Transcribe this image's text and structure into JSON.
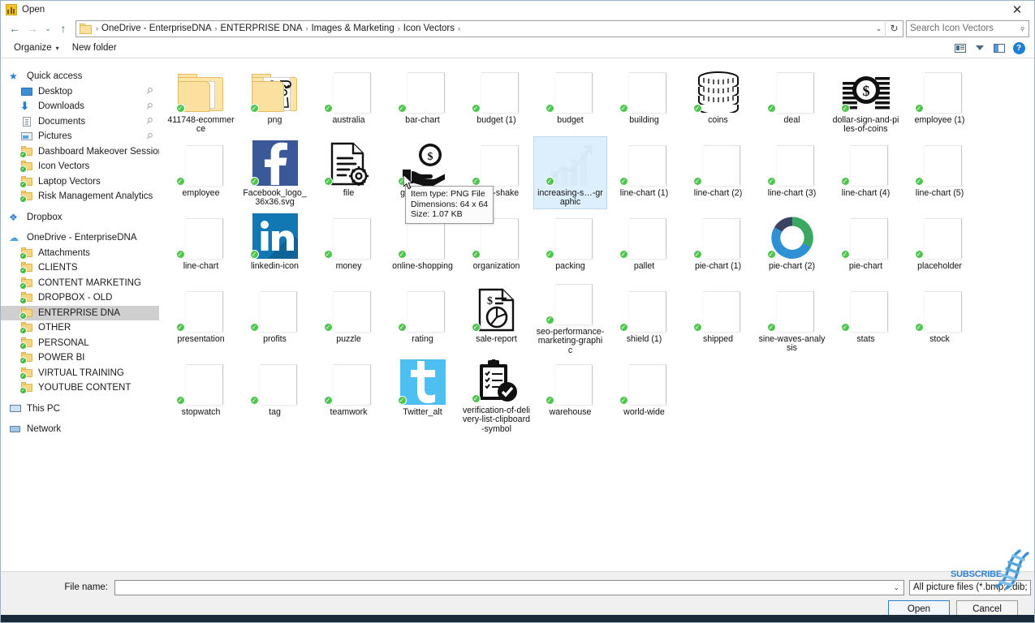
{
  "window": {
    "title": "Open",
    "close_label": "✕",
    "icon": "chart-app-icon"
  },
  "nav": {
    "back": "←",
    "forward": "→",
    "recent": "⌄",
    "up": "↑",
    "breadcrumbs": [
      "OneDrive - EnterpriseDNA",
      "ENTERPRISE DNA",
      "Images & Marketing",
      "Icon Vectors"
    ],
    "separator": "›",
    "address_caret": "⌄",
    "refresh": "↻",
    "search_placeholder": "Search Icon Vectors",
    "search_icon": "search-icon"
  },
  "command_bar": {
    "organize": "Organize",
    "organize_caret": "▾",
    "new_folder": "New folder",
    "view_icon": "view-layout-icon",
    "view_caret_icon": "chevron-down-icon",
    "preview_pane_icon": "preview-pane-icon",
    "help_icon": "help-icon",
    "help_glyph": "?"
  },
  "sidebar": {
    "items": [
      {
        "label": "Quick access",
        "icon": "star-icon",
        "kind": "group",
        "pinned": false
      },
      {
        "label": "Desktop",
        "icon": "desktop-icon",
        "kind": "child",
        "pinned": true
      },
      {
        "label": "Downloads",
        "icon": "downloads-icon",
        "kind": "child",
        "pinned": true
      },
      {
        "label": "Documents",
        "icon": "documents-icon",
        "kind": "child",
        "pinned": true
      },
      {
        "label": "Pictures",
        "icon": "pictures-icon",
        "kind": "child",
        "pinned": true
      },
      {
        "label": "Dashboard Makeover Session",
        "icon": "folder-synced-icon",
        "kind": "child",
        "pinned": false
      },
      {
        "label": "Icon Vectors",
        "icon": "folder-synced-icon",
        "kind": "child",
        "pinned": false
      },
      {
        "label": "Laptop Vectors",
        "icon": "folder-synced-icon",
        "kind": "child",
        "pinned": false
      },
      {
        "label": "Risk Management Analytics",
        "icon": "folder-synced-icon",
        "kind": "child",
        "pinned": false
      },
      {
        "label": "Dropbox",
        "icon": "dropbox-icon",
        "kind": "group",
        "pinned": false
      },
      {
        "label": "OneDrive - EnterpriseDNA",
        "icon": "onedrive-icon",
        "kind": "group",
        "pinned": false
      },
      {
        "label": "Attachments",
        "icon": "folder-synced-icon",
        "kind": "child",
        "pinned": false
      },
      {
        "label": "CLIENTS",
        "icon": "folder-synced-icon",
        "kind": "child",
        "pinned": false
      },
      {
        "label": "CONTENT MARKETING",
        "icon": "folder-synced-icon",
        "kind": "child",
        "pinned": false
      },
      {
        "label": "DROPBOX - OLD",
        "icon": "folder-synced-icon",
        "kind": "child",
        "pinned": false
      },
      {
        "label": "ENTERPRISE DNA",
        "icon": "folder-synced-icon",
        "kind": "child",
        "pinned": false,
        "selected": true
      },
      {
        "label": "OTHER",
        "icon": "folder-synced-icon",
        "kind": "child",
        "pinned": false
      },
      {
        "label": "PERSONAL",
        "icon": "folder-synced-icon",
        "kind": "child",
        "pinned": false
      },
      {
        "label": "POWER BI",
        "icon": "folder-synced-icon",
        "kind": "child",
        "pinned": false
      },
      {
        "label": "VIRTUAL TRAINING",
        "icon": "folder-synced-icon",
        "kind": "child",
        "pinned": false
      },
      {
        "label": "YOUTUBE CONTENT",
        "icon": "folder-synced-icon",
        "kind": "child",
        "pinned": false
      },
      {
        "label": "This PC",
        "icon": "this-pc-icon",
        "kind": "group",
        "pinned": false
      },
      {
        "label": "Network",
        "icon": "network-icon",
        "kind": "group",
        "pinned": false
      }
    ]
  },
  "files": {
    "items": [
      {
        "name": "411748-ecommerce",
        "thumb": "folder"
      },
      {
        "name": "png",
        "thumb": "folder-people"
      },
      {
        "name": "australia",
        "thumb": "blank"
      },
      {
        "name": "bar-chart",
        "thumb": "blank"
      },
      {
        "name": "budget (1)",
        "thumb": "blank"
      },
      {
        "name": "budget",
        "thumb": "blank"
      },
      {
        "name": "building",
        "thumb": "blank"
      },
      {
        "name": "coins",
        "thumb": "coins"
      },
      {
        "name": "deal",
        "thumb": "blank"
      },
      {
        "name": "dollar-sign-and-piles-of-coins",
        "thumb": "dollar-piles"
      },
      {
        "name": "employee (1)",
        "thumb": "blank"
      },
      {
        "name": "employee",
        "thumb": "blank"
      },
      {
        "name": "Facebook_logo_36x36.svg",
        "thumb": "facebook"
      },
      {
        "name": "file",
        "thumb": "file-gear"
      },
      {
        "name": "give-money",
        "thumb": "give-money"
      },
      {
        "name": "hand-shake",
        "thumb": "blank"
      },
      {
        "name": "increasing-stocks-graphic",
        "thumb": "growth-chart",
        "hover": true,
        "label_display": "increasing-s…-graphic"
      },
      {
        "name": "line-chart (1)",
        "thumb": "blank"
      },
      {
        "name": "line-chart (2)",
        "thumb": "blank"
      },
      {
        "name": "line-chart (3)",
        "thumb": "blank"
      },
      {
        "name": "line-chart (4)",
        "thumb": "blank"
      },
      {
        "name": "line-chart (5)",
        "thumb": "blank"
      },
      {
        "name": "line-chart",
        "thumb": "blank"
      },
      {
        "name": "linkedin-icon",
        "thumb": "linkedin"
      },
      {
        "name": "money",
        "thumb": "blank"
      },
      {
        "name": "online-shopping",
        "thumb": "blank"
      },
      {
        "name": "organization",
        "thumb": "blank"
      },
      {
        "name": "packing",
        "thumb": "blank"
      },
      {
        "name": "pallet",
        "thumb": "blank"
      },
      {
        "name": "pie-chart (1)",
        "thumb": "blank"
      },
      {
        "name": "pie-chart (2)",
        "thumb": "donut"
      },
      {
        "name": "pie-chart",
        "thumb": "blank"
      },
      {
        "name": "placeholder",
        "thumb": "blank"
      },
      {
        "name": "presentation",
        "thumb": "blank"
      },
      {
        "name": "profits",
        "thumb": "blank"
      },
      {
        "name": "puzzle",
        "thumb": "blank"
      },
      {
        "name": "rating",
        "thumb": "blank"
      },
      {
        "name": "sale-report",
        "thumb": "sale-report"
      },
      {
        "name": "seo-performance-marketing-graphic",
        "thumb": "blank"
      },
      {
        "name": "shield (1)",
        "thumb": "blank"
      },
      {
        "name": "shipped",
        "thumb": "blank"
      },
      {
        "name": "sine-waves-analysis",
        "thumb": "blank"
      },
      {
        "name": "stats",
        "thumb": "blank"
      },
      {
        "name": "stock",
        "thumb": "blank"
      },
      {
        "name": "stopwatch",
        "thumb": "blank"
      },
      {
        "name": "tag",
        "thumb": "blank"
      },
      {
        "name": "teamwork",
        "thumb": "blank"
      },
      {
        "name": "Twitter_alt",
        "thumb": "twitter"
      },
      {
        "name": "verification-of-delivery-list-clipboard-symbol",
        "thumb": "clipboard-check"
      },
      {
        "name": "warehouse",
        "thumb": "blank"
      },
      {
        "name": "world-wide",
        "thumb": "blank"
      }
    ]
  },
  "tooltip": {
    "item_type": "Item type: PNG File",
    "dimensions": "Dimensions: 64 x 64",
    "size": "Size: 1.07 KB"
  },
  "watermark": {
    "text": "SUBSCRIBE",
    "icon": "dna-helix-icon",
    "color": "#2f7fd0"
  },
  "footer": {
    "file_name_label": "File name:",
    "file_name_value": "",
    "file_name_placeholder": "",
    "file_name_caret": "⌄",
    "file_type": "All picture files (*.bmp;*.dib;",
    "open_label": "Open",
    "cancel_label": "Cancel"
  },
  "colors": {
    "accent": "#2e7fd0",
    "sync_green": "#4ec64e",
    "folder_yellow": "#fbe5a8",
    "selection_gray": "#cfcfcf",
    "hover_blue": "#ddeefc",
    "facebook": "#3b5998",
    "linkedin": "#1178b3",
    "twitter": "#4dbff0"
  }
}
